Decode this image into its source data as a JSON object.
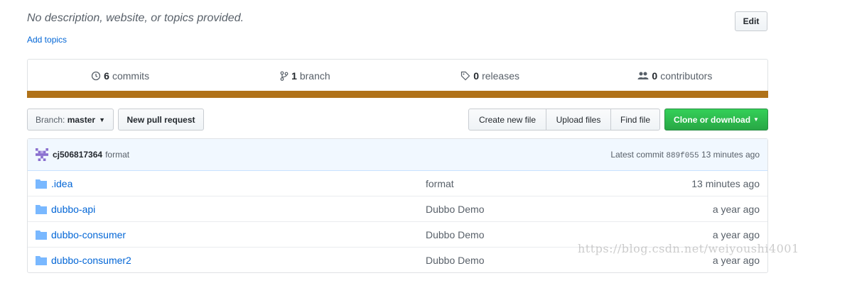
{
  "repo": {
    "description": "No description, website, or topics provided.",
    "add_topics": "Add topics",
    "edit_label": "Edit"
  },
  "summary": {
    "commits": {
      "count": "6",
      "label": "commits",
      "icon": "history-icon"
    },
    "branches": {
      "count": "1",
      "label": "branch",
      "icon": "branch-icon"
    },
    "releases": {
      "count": "0",
      "label": "releases",
      "icon": "tag-icon"
    },
    "contributors": {
      "count": "0",
      "label": "contributors",
      "icon": "people-icon"
    },
    "language_color": "#b07219"
  },
  "toolbar": {
    "branch_prefix": "Branch:",
    "branch_name": "master",
    "new_pr": "New pull request",
    "create_file": "Create new file",
    "upload_files": "Upload files",
    "find_file": "Find file",
    "clone": "Clone or download"
  },
  "latest_commit": {
    "author": "cj506817364",
    "message": "format",
    "prefix": "Latest commit",
    "sha": "889f055",
    "age": "13 minutes ago"
  },
  "files": [
    {
      "name": ".idea",
      "message": "format",
      "age": "13 minutes ago"
    },
    {
      "name": "dubbo-api",
      "message": "Dubbo Demo",
      "age": "a year ago"
    },
    {
      "name": "dubbo-consumer",
      "message": "Dubbo Demo",
      "age": "a year ago"
    },
    {
      "name": "dubbo-consumer2",
      "message": "Dubbo Demo",
      "age": "a year ago"
    }
  ],
  "watermark": "https://blog.csdn.net/weiyoushi4001",
  "colors": {
    "link": "#0366d6",
    "clone_button": "#28a745",
    "commit_bar": "#f1f8ff"
  }
}
